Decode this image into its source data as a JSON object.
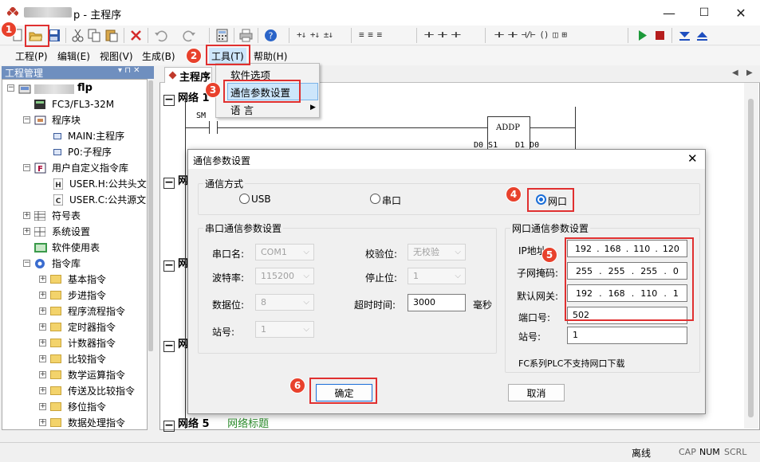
{
  "window": {
    "title": "p - 主程序",
    "controls": {
      "minimize": "—",
      "maximize": "☐",
      "close": "✕"
    }
  },
  "menubar": {
    "items": [
      "工程(P)",
      "编辑(E)",
      "视图(V)",
      "生成(B)",
      "工具(T)",
      "帮助(H)"
    ]
  },
  "tools_menu": {
    "items": [
      "软件选项",
      "通信参数设置",
      "语 言"
    ]
  },
  "left_panel": {
    "title": "工程管理",
    "title_controls": "▾ ⊓ ✕",
    "tree": [
      {
        "label": "flp",
        "level": 0
      },
      {
        "label": "FC3/FL3-32M",
        "level": 1
      },
      {
        "label": "程序块",
        "level": 1
      },
      {
        "label": "MAIN:主程序",
        "level": 2
      },
      {
        "label": "P0:子程序",
        "level": 2
      },
      {
        "label": "用户自定义指令库",
        "level": 1
      },
      {
        "label": "USER.H:公共头文",
        "level": 2
      },
      {
        "label": "USER.C:公共源文",
        "level": 2
      },
      {
        "label": "符号表",
        "level": 1
      },
      {
        "label": "系统设置",
        "level": 1
      },
      {
        "label": "软件使用表",
        "level": 1
      },
      {
        "label": "指令库",
        "level": 1
      },
      {
        "label": "基本指令",
        "level": 2
      },
      {
        "label": "步进指令",
        "level": 2
      },
      {
        "label": "程序流程指令",
        "level": 2
      },
      {
        "label": "定时器指令",
        "level": 2
      },
      {
        "label": "计数器指令",
        "level": 2
      },
      {
        "label": "比较指令",
        "level": 2
      },
      {
        "label": "数学运算指令",
        "level": 2
      },
      {
        "label": "传送及比较指令",
        "level": 2
      },
      {
        "label": "移位指令",
        "level": 2
      },
      {
        "label": "数据处理指令",
        "level": 2
      }
    ]
  },
  "editor": {
    "tab_label": "主程序",
    "nav_left": "◀",
    "nav_right": "▶",
    "networks": [
      {
        "label": "网络 1"
      },
      {
        "label": "网"
      },
      {
        "label": "网"
      },
      {
        "label": "网"
      },
      {
        "label": "网络 5",
        "comment": "网络标题"
      }
    ],
    "ladder": {
      "contact": "SM",
      "block_name": "ADDP",
      "pin_left": "D0 S1",
      "pin_right": "D1 D0"
    }
  },
  "dialog": {
    "title": "通信参数设置",
    "comm_mode": {
      "legend": "通信方式",
      "options": [
        "USB",
        "串口",
        "网口"
      ],
      "selected": "网口"
    },
    "serial": {
      "legend": "串口通信参数设置",
      "port_label": "串口名:",
      "port_value": "COM1",
      "baud_label": "波特率:",
      "baud_value": "115200",
      "databits_label": "数据位:",
      "databits_value": "8",
      "station_label": "站号:",
      "station_value": "1",
      "parity_label": "校验位:",
      "parity_value": "无校验",
      "stopbits_label": "停止位:",
      "stopbits_value": "1",
      "timeout_label": "超时时间:",
      "timeout_value": "3000",
      "timeout_unit": "毫秒"
    },
    "network": {
      "legend": "网口通信参数设置",
      "ip_label": "IP地址:",
      "ip": [
        "192",
        "168",
        "110",
        "120"
      ],
      "mask_label": "子网掩码:",
      "mask": [
        "255",
        "255",
        "255",
        "0"
      ],
      "gateway_label": "默认网关:",
      "gateway": [
        "192",
        "168",
        "110",
        "1"
      ],
      "port_label": "端口号:",
      "port_value": "502",
      "station_label": "站号:",
      "station_value": "1",
      "note": "FC系列PLC不支持网口下载"
    },
    "ok_label": "确定",
    "cancel_label": "取消"
  },
  "annotations": [
    "1",
    "2",
    "3",
    "4",
    "5",
    "6"
  ],
  "statusbar": {
    "state": "离线",
    "cap": "CAP",
    "num": "NUM",
    "scrl": "SCRL"
  },
  "colors": {
    "annotation_red": "#e03030",
    "badge_red": "#e8412c",
    "panel_header": "#6f8fbf",
    "menu_highlight": "#cde6fb",
    "comment_green": "#2c8c2c"
  }
}
